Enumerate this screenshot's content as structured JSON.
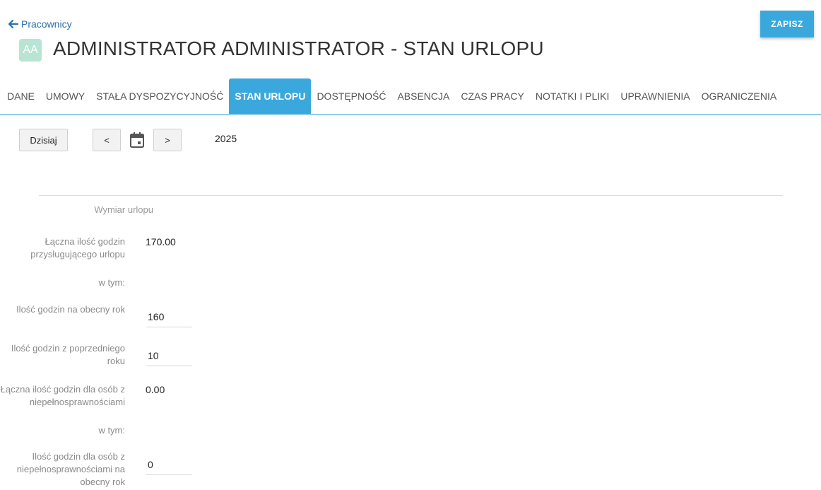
{
  "header": {
    "back_label": "Pracownicy",
    "avatar_initials": "AA",
    "title": "ADMINISTRATOR ADMINISTRATOR - STAN URLOPU",
    "save_label": "ZAPISZ"
  },
  "tabs": [
    {
      "label": "DANE"
    },
    {
      "label": "UMOWY"
    },
    {
      "label": "STAŁA DYSPOZYCYJNOŚĆ"
    },
    {
      "label": "STAN URLOPU",
      "active": true
    },
    {
      "label": "DOSTĘPNOŚĆ"
    },
    {
      "label": "ABSENCJA"
    },
    {
      "label": "CZAS PRACY"
    },
    {
      "label": "NOTATKI I PLIKI"
    },
    {
      "label": "UPRAWNIENIA"
    },
    {
      "label": "OGRANICZENIA"
    }
  ],
  "toolbar": {
    "today_label": "Dzisiaj",
    "prev_label": "<",
    "next_label": ">",
    "calendar_icon": "calendar-icon",
    "year": "2025"
  },
  "section": {
    "title": "Wymiar urlopu",
    "total_hours_label": "Łączna ilość godzin przysługującego urlopu",
    "total_hours_value": "170.00",
    "including_label_1": "w tym:",
    "current_year_label": "Ilość godzin na obecny rok",
    "current_year_value": "160",
    "previous_year_label": "Ilość godzin z poprzedniego roku",
    "previous_year_value": "10",
    "disabled_total_label": "Łączna ilość godzin dla osób z niepełnosprawnościami",
    "disabled_total_value": "0.00",
    "including_label_2": "w tym:",
    "disabled_current_label": "Ilość godzin dla osób z niepełnosprawnościami na obecny rok",
    "disabled_current_value": "0"
  },
  "colors": {
    "accent": "#3aa8dd",
    "link": "#2a6fb0",
    "avatar_bg": "#b9e4d4"
  }
}
